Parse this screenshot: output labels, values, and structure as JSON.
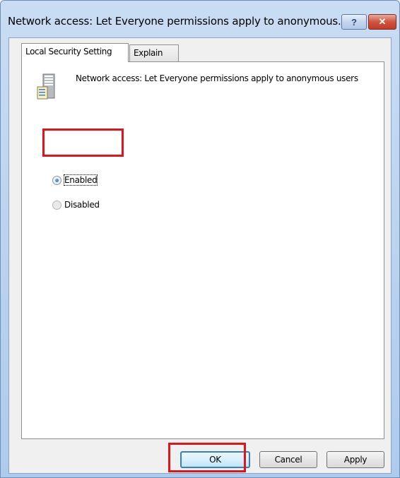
{
  "window": {
    "title": "Network access: Let Everyone permissions apply to anonymous...",
    "help_label": "?",
    "close_label": "✕"
  },
  "tabs": [
    {
      "label": "Local Security Setting",
      "active": true
    },
    {
      "label": "Explain",
      "active": false
    }
  ],
  "policy": {
    "icon": "server-policy-icon",
    "description": "Network access: Let Everyone permissions apply to anonymous users"
  },
  "options": [
    {
      "label": "Enabled",
      "selected": true
    },
    {
      "label": "Disabled",
      "selected": false
    }
  ],
  "buttons": {
    "ok": "OK",
    "cancel": "Cancel",
    "apply": "Apply"
  },
  "colors": {
    "highlight": "#e0141b",
    "titlebar": "#b9d1ef"
  }
}
